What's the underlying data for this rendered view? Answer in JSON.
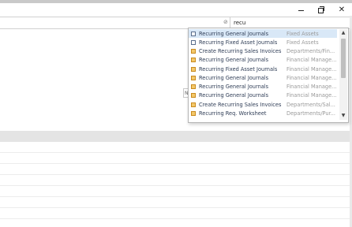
{
  "window": {
    "minimize_icon": "minimize-icon",
    "restore_icon": "restore-icon",
    "close_label": "✕"
  },
  "search": {
    "value": "recu",
    "pin_icon": "⊘"
  },
  "side_label": "N",
  "results": [
    {
      "icon": "page",
      "name": "Recurring General Journals",
      "category": "Fixed Assets"
    },
    {
      "icon": "page",
      "name": "Recurring Fixed Asset Journals",
      "category": "Fixed Assets"
    },
    {
      "icon": "task",
      "name": "Create Recurring Sales Invoices",
      "category": "Departments/Fin..."
    },
    {
      "icon": "task",
      "name": "Recurring General Journals",
      "category": "Financial Manage..."
    },
    {
      "icon": "task",
      "name": "Recurring Fixed Asset Journals",
      "category": "Financial Manage..."
    },
    {
      "icon": "task",
      "name": "Recurring General Journals",
      "category": "Financial Manage..."
    },
    {
      "icon": "task",
      "name": "Recurring General Journals",
      "category": "Financial Manage..."
    },
    {
      "icon": "task",
      "name": "Recurring General Journals",
      "category": "Financial Manage..."
    },
    {
      "icon": "task",
      "name": "Create Recurring Sales Invoices",
      "category": "Departments/Sal..."
    },
    {
      "icon": "task",
      "name": "Recurring Req. Worksheet",
      "category": "Departments/Pur..."
    }
  ],
  "scroll": {
    "up": "▲",
    "down": "▼"
  },
  "colors": {
    "selected_row": "#d9e8f7",
    "section_header": "#e4e4e4"
  }
}
